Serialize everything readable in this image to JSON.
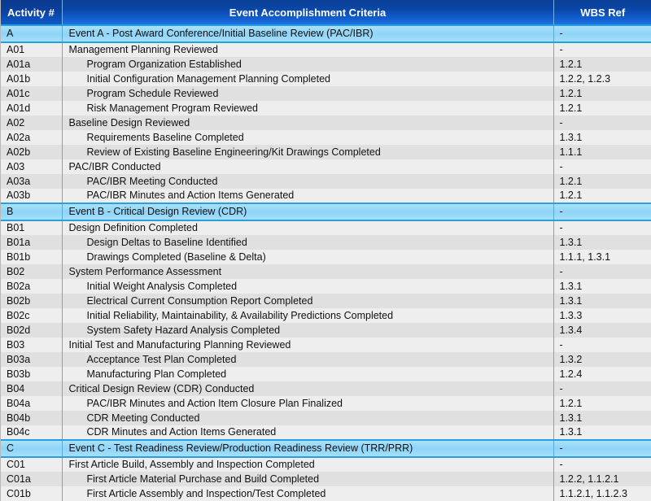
{
  "table": {
    "columns": [
      {
        "key": "activity",
        "label": "Activity #"
      },
      {
        "key": "criteria",
        "label": "Event Accomplishment Criteria"
      },
      {
        "key": "wbs",
        "label": "WBS Ref"
      }
    ],
    "colors": {
      "header_gradient_top": "#0b3f96",
      "header_gradient_bottom": "#1b74e4",
      "header_text": "#ffffff",
      "section_row_fill": "#8fd4f7",
      "section_row_border": "#2a9fe0",
      "row_stripe_light": "#eeeeee",
      "row_stripe_dark": "#e0e0e0",
      "body_text": "#111111",
      "grid_line": "#9a9a9a"
    },
    "rows": [
      {
        "type": "section",
        "activity": "A",
        "indent": 0,
        "criteria": "Event A - Post Award Conference/Initial Baseline Review (PAC/IBR)",
        "wbs": "-"
      },
      {
        "type": "data",
        "activity": "A01",
        "indent": 1,
        "criteria": "Management Planning Reviewed",
        "wbs": "-"
      },
      {
        "type": "data",
        "activity": "A01a",
        "indent": 2,
        "criteria": "Program Organization Established",
        "wbs": "1.2.1"
      },
      {
        "type": "data",
        "activity": "A01b",
        "indent": 2,
        "criteria": "Initial Configuration Management Planning Completed",
        "wbs": "1.2.2, 1.2.3"
      },
      {
        "type": "data",
        "activity": "A01c",
        "indent": 2,
        "criteria": "Program Schedule Reviewed",
        "wbs": "1.2.1"
      },
      {
        "type": "data",
        "activity": "A01d",
        "indent": 2,
        "criteria": "Risk Management Program Reviewed",
        "wbs": "1.2.1"
      },
      {
        "type": "data",
        "activity": "A02",
        "indent": 1,
        "criteria": "Baseline Design Reviewed",
        "wbs": "-"
      },
      {
        "type": "data",
        "activity": "A02a",
        "indent": 2,
        "criteria": "Requirements Baseline Completed",
        "wbs": "1.3.1"
      },
      {
        "type": "data",
        "activity": "A02b",
        "indent": 2,
        "criteria": "Review of Existing Baseline Engineering/Kit Drawings Completed",
        "wbs": "1.1.1"
      },
      {
        "type": "data",
        "activity": "A03",
        "indent": 1,
        "criteria": "PAC/IBR Conducted",
        "wbs": "-"
      },
      {
        "type": "data",
        "activity": "A03a",
        "indent": 2,
        "criteria": "PAC/IBR Meeting Conducted",
        "wbs": "1.2.1"
      },
      {
        "type": "data",
        "activity": "A03b",
        "indent": 2,
        "criteria": "PAC/IBR Minutes and Action Items Generated",
        "wbs": "1.2.1"
      },
      {
        "type": "section",
        "activity": "B",
        "indent": 0,
        "criteria": "Event B - Critical Design Review (CDR)",
        "wbs": "-"
      },
      {
        "type": "data",
        "activity": "B01",
        "indent": 1,
        "criteria": "Design Definition Completed",
        "wbs": "-"
      },
      {
        "type": "data",
        "activity": "B01a",
        "indent": 2,
        "criteria": "Design Deltas to Baseline Identified",
        "wbs": "1.3.1"
      },
      {
        "type": "data",
        "activity": "B01b",
        "indent": 2,
        "criteria": "Drawings Completed (Baseline & Delta)",
        "wbs": "1.1.1, 1.3.1"
      },
      {
        "type": "data",
        "activity": "B02",
        "indent": 1,
        "criteria": "System Performance Assessment",
        "wbs": "-"
      },
      {
        "type": "data",
        "activity": "B02a",
        "indent": 2,
        "criteria": "Initial Weight Analysis Completed",
        "wbs": "1.3.1"
      },
      {
        "type": "data",
        "activity": "B02b",
        "indent": 2,
        "criteria": "Electrical Current Consumption Report Completed",
        "wbs": "1.3.1"
      },
      {
        "type": "data",
        "activity": "B02c",
        "indent": 2,
        "criteria": "Initial Reliability, Maintainability, & Availability Predictions Completed",
        "wbs": "1.3.3"
      },
      {
        "type": "data",
        "activity": "B02d",
        "indent": 2,
        "criteria": "System Safety Hazard Analysis Completed",
        "wbs": "1.3.4"
      },
      {
        "type": "data",
        "activity": "B03",
        "indent": 1,
        "criteria": "Initial Test and Manufacturing Planning Reviewed",
        "wbs": "-"
      },
      {
        "type": "data",
        "activity": "B03a",
        "indent": 2,
        "criteria": "Acceptance Test Plan Completed",
        "wbs": "1.3.2"
      },
      {
        "type": "data",
        "activity": "B03b",
        "indent": 2,
        "criteria": "Manufacturing Plan Completed",
        "wbs": "1.2.4"
      },
      {
        "type": "data",
        "activity": "B04",
        "indent": 1,
        "criteria": "Critical Design Review (CDR) Conducted",
        "wbs": "-"
      },
      {
        "type": "data",
        "activity": "B04a",
        "indent": 2,
        "criteria": "PAC/IBR Minutes and Action Item Closure Plan Finalized",
        "wbs": "1.2.1"
      },
      {
        "type": "data",
        "activity": "B04b",
        "indent": 2,
        "criteria": "CDR Meeting Conducted",
        "wbs": "1.3.1"
      },
      {
        "type": "data",
        "activity": "B04c",
        "indent": 2,
        "criteria": "CDR Minutes and Action Items Generated",
        "wbs": "1.3.1"
      },
      {
        "type": "section",
        "activity": "C",
        "indent": 0,
        "criteria": "Event C - Test Readiness Review/Production Readiness Review (TRR/PRR)",
        "wbs": "-"
      },
      {
        "type": "data",
        "activity": "C01",
        "indent": 1,
        "criteria": "First Article Build, Assembly and Inspection Completed",
        "wbs": "-"
      },
      {
        "type": "data",
        "activity": "C01a",
        "indent": 2,
        "criteria": "First Article Material Purchase and Build Completed",
        "wbs": "1.2.2, 1.1.2.1"
      },
      {
        "type": "data",
        "activity": "C01b",
        "indent": 2,
        "criteria": "First Article Assembly and Inspection/Test Completed",
        "wbs": "1.1.2.1, 1.1.2.3"
      }
    ]
  }
}
